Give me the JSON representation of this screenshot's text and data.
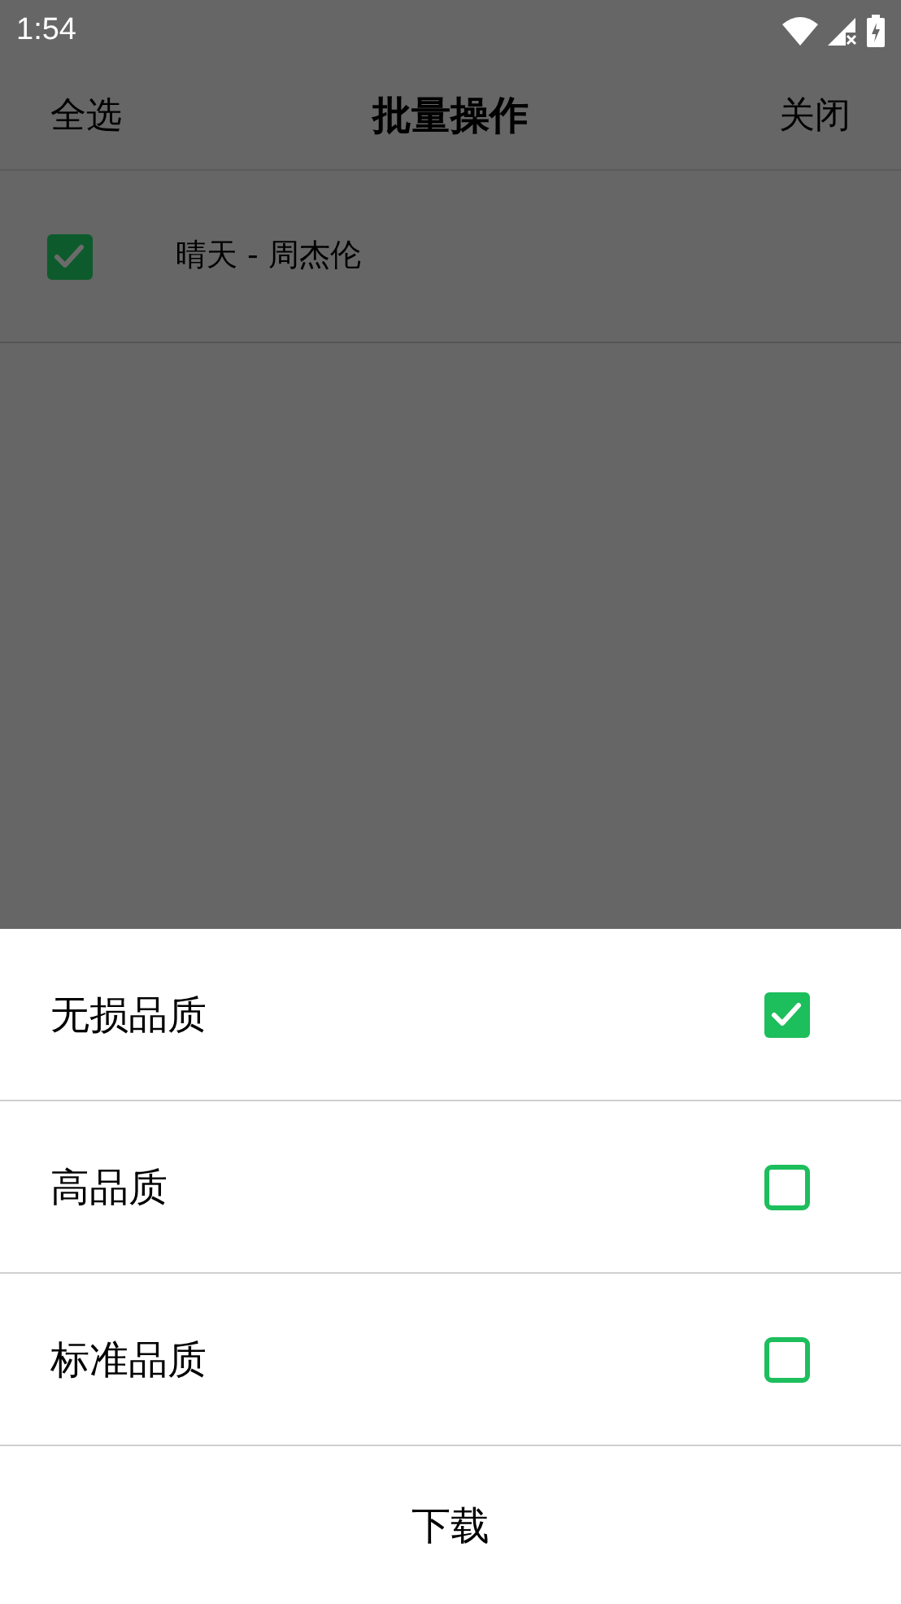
{
  "status_bar": {
    "time": "1:54"
  },
  "header": {
    "left": "全选",
    "title": "批量操作",
    "right": "关闭"
  },
  "songs": [
    {
      "title": "晴天 - 周杰伦",
      "checked": true
    }
  ],
  "quality_sheet": {
    "options": [
      {
        "label": "无损品质",
        "checked": true
      },
      {
        "label": "高品质",
        "checked": false
      },
      {
        "label": "标准品质",
        "checked": false
      }
    ],
    "action": "下载"
  }
}
